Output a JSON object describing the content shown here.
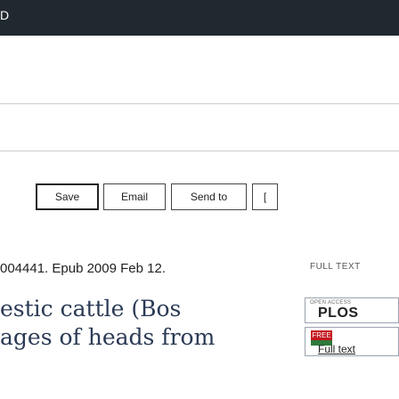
{
  "header": {
    "truncated_glyph": "D",
    "band_color": "#20292f"
  },
  "actions": {
    "buttons": [
      {
        "label": "Save"
      },
      {
        "label": "Email"
      },
      {
        "label": "Send to"
      },
      {
        "label": "["
      }
    ]
  },
  "article": {
    "citation": "004441. Epub 2009 Feb 12.",
    "title_line_1": "estic cattle (Bos",
    "title_line_2": "ages of heads from"
  },
  "full_text_links": {
    "label": "FULL TEXT",
    "plos": {
      "tag": "OPEN ACCESS",
      "name": "PLOS"
    },
    "pmc": {
      "badge": "FREE",
      "link": "Full text"
    }
  },
  "colors": {
    "title": "#2b3a55",
    "free_badge": "#c4171e",
    "pmc_green": "#2e7a3a"
  }
}
